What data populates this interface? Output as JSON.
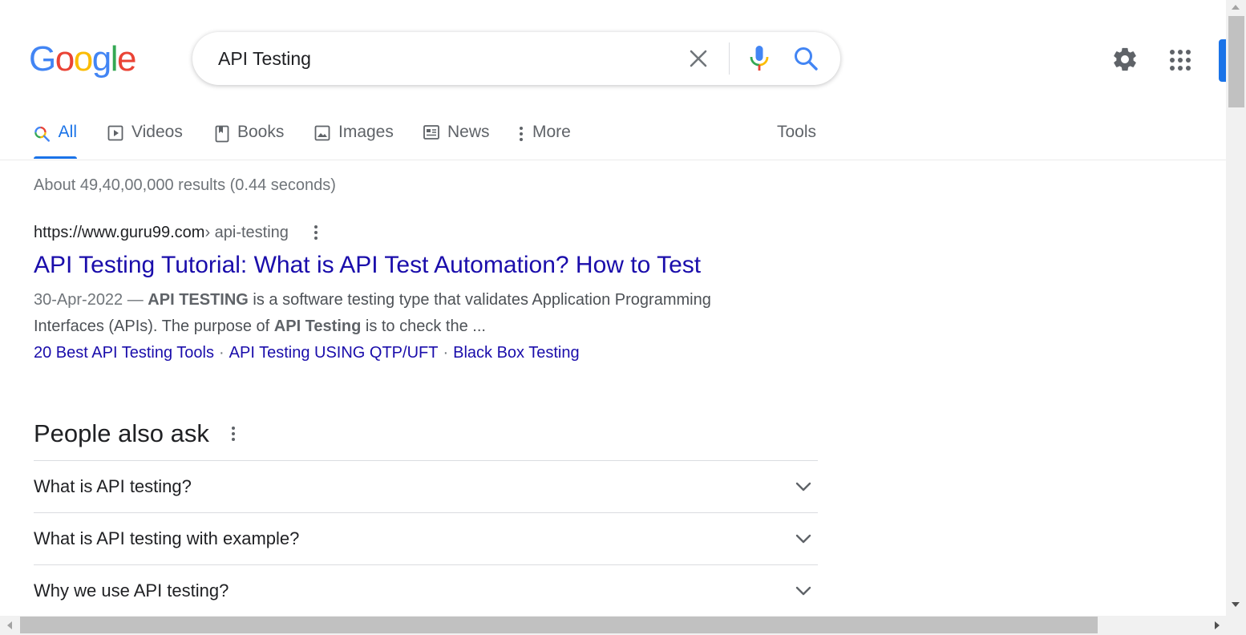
{
  "header": {
    "logo_text": "Google",
    "search": {
      "value": "API Testing"
    }
  },
  "tabs": [
    {
      "label": "All",
      "icon": "search-multicolor-icon",
      "active": true
    },
    {
      "label": "Videos",
      "icon": "video-icon"
    },
    {
      "label": "Books",
      "icon": "book-icon"
    },
    {
      "label": "Images",
      "icon": "image-icon"
    },
    {
      "label": "News",
      "icon": "news-icon"
    },
    {
      "label": "More",
      "icon": "more-vert-icon"
    }
  ],
  "tools_label": "Tools",
  "result_stats": "About 49,40,00,000 results (0.44 seconds)",
  "result": {
    "url_domain": "https://www.guru99.com",
    "url_path": " › api-testing",
    "title": "API Testing Tutorial: What is API Test Automation? How to Test",
    "snippet_date": "30-Apr-2022 — ",
    "snippet_b1": "API TESTING",
    "snippet_t1": " is a software testing type that validates Application Programming Interfaces (APIs). The purpose of ",
    "snippet_b2": "API Testing",
    "snippet_t2": " is to check the ...",
    "sitelinks": [
      "20 Best API Testing Tools",
      "API Testing USING QTP/UFT",
      "Black Box Testing"
    ],
    "sitelink_separator": "·"
  },
  "people_also_ask": {
    "title": "People also ask",
    "questions": [
      "What is API testing?",
      "What is API testing with example?",
      "Why we use API testing?"
    ]
  },
  "colors": {
    "link": "#1a0dab",
    "accent": "#1a73e8"
  }
}
